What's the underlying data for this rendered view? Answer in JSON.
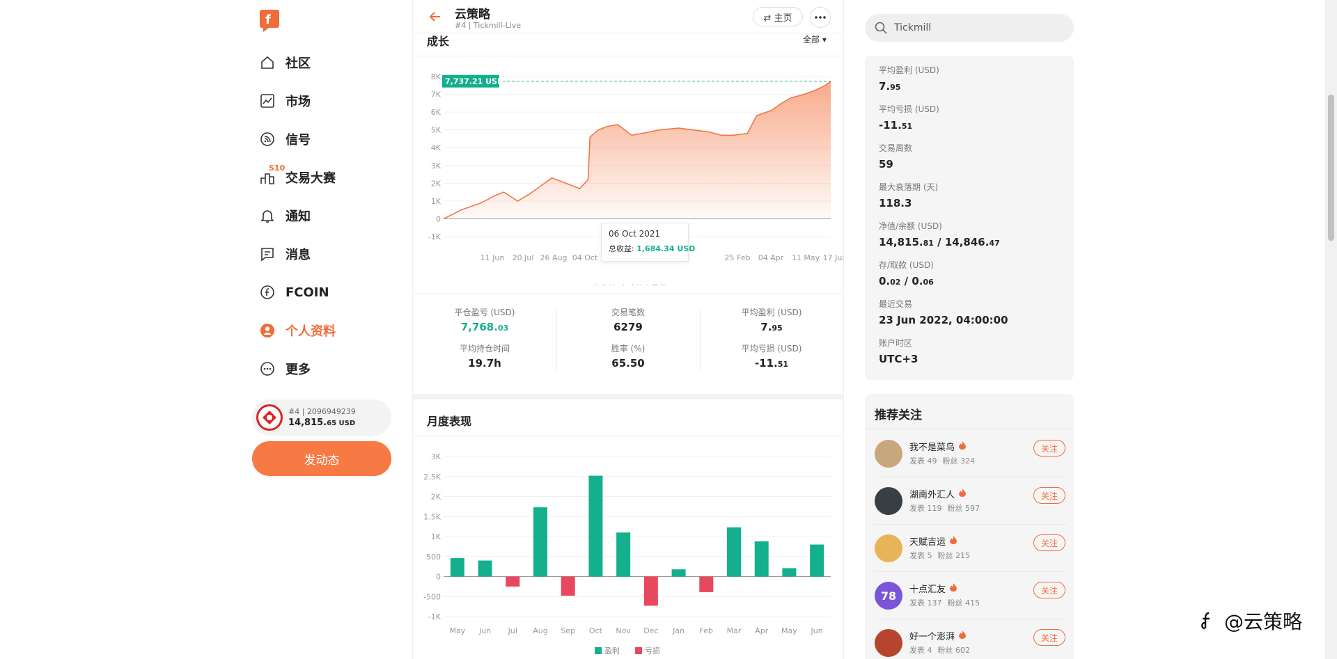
{
  "sidebar": {
    "items": [
      {
        "label": "社区",
        "icon": "home-icon"
      },
      {
        "label": "市场",
        "icon": "chart-line-icon"
      },
      {
        "label": "信号",
        "icon": "rss-icon"
      },
      {
        "label": "交易大赛",
        "icon": "podium-icon",
        "badge": "S10"
      },
      {
        "label": "通知",
        "icon": "bell-icon"
      },
      {
        "label": "消息",
        "icon": "message-icon"
      },
      {
        "label": "FCOIN",
        "icon": "fcoin-icon"
      },
      {
        "label": "个人资料",
        "icon": "user-icon"
      },
      {
        "label": "更多",
        "icon": "more-circle-icon"
      }
    ],
    "account": {
      "id": "#4 | 2096949239",
      "balance_main": "14,815.",
      "balance_sub": "65 USD"
    },
    "post_button": "发动态"
  },
  "header": {
    "title": "云策略",
    "subtitle": "#4 | Tickmill-Live",
    "home_label": "⇄ 主页"
  },
  "growth": {
    "title": "成长",
    "filter": "全部 ▾",
    "tooltip": {
      "date": "06 Oct 2021",
      "label": "总收益: ",
      "value": "1,684.34 USD"
    },
    "last_value_label": "7,737.21 USD"
  },
  "stats": [
    {
      "label": "平仓盈亏 (USD)",
      "main": "7,768.",
      "sub": "03",
      "green": true
    },
    {
      "label": "交易笔数",
      "main": "6279",
      "sub": ""
    },
    {
      "label": "平均盈利 (USD)",
      "main": "7.",
      "sub": "95"
    },
    {
      "label": "平均持仓时间",
      "main": "19.7h",
      "sub": ""
    },
    {
      "label": "胜率 (%)",
      "main": "65.50",
      "sub": ""
    },
    {
      "label": "平均亏损 (USD)",
      "main": "-11.",
      "sub": "51"
    }
  ],
  "monthly": {
    "title": "月度表现"
  },
  "search": {
    "value": "Tickmill"
  },
  "info": [
    {
      "label": "平均盈利 (USD)",
      "main": "7.",
      "sub": "95",
      "rest": ""
    },
    {
      "label": "平均亏损 (USD)",
      "main": "-11.",
      "sub": "51",
      "rest": ""
    },
    {
      "label": "交易周数",
      "main": "59",
      "sub": "",
      "rest": ""
    },
    {
      "label": "最大衰落期 (天)",
      "main": "118.3",
      "sub": "",
      "rest": ""
    },
    {
      "label": "净值/余额 (USD)",
      "main": "14,815.",
      "sub": "81",
      "rest": " / 14,846.",
      "rest_sub": "47"
    },
    {
      "label": "存/取款 (USD)",
      "main": "0.",
      "sub": "02",
      "rest": " / 0.",
      "rest_sub": "06"
    },
    {
      "label": "最近交易",
      "main": "23 Jun 2022, 04:00:00",
      "sub": "",
      "rest": ""
    },
    {
      "label": "账户时区",
      "main": "UTC+3",
      "sub": "",
      "rest": ""
    }
  ],
  "recommend": {
    "title": "推荐关注",
    "follow_label": "关注",
    "users": [
      {
        "name": "我不是菜鸟",
        "posts": "发表 49",
        "fans": "粉丝 324",
        "avatar_color": "#c9a77c",
        "avatar_text": ""
      },
      {
        "name": "湖南外汇人",
        "posts": "发表 119",
        "fans": "粉丝 597",
        "avatar_color": "#3a3f44",
        "avatar_text": ""
      },
      {
        "name": "天赋吉运",
        "posts": "发表 5",
        "fans": "粉丝 215",
        "avatar_color": "#e8b45a",
        "avatar_text": ""
      },
      {
        "name": "十点汇友",
        "posts": "发表 137",
        "fans": "粉丝 415",
        "avatar_color": "#7a55d8",
        "avatar_text": "78"
      },
      {
        "name": "好一个澎湃",
        "posts": "发表 4",
        "fans": "粉丝 602",
        "avatar_color": "#b5452f",
        "avatar_text": ""
      }
    ]
  },
  "watermark": "@云策略",
  "chart_data": [
    {
      "type": "area",
      "title": "成长",
      "series": [
        {
          "name": "总收益 (包含持仓盈亏)"
        }
      ],
      "x_ticks": [
        "11 Jun",
        "20 Jul",
        "26 Aug",
        "04 Oct",
        "",
        "",
        "25 Feb",
        "04 Apr",
        "11 May",
        "17 Jun"
      ],
      "y_ticks": [
        "8K",
        "7K",
        "6K",
        "5K",
        "4K",
        "3K",
        "2K",
        "1K",
        "0",
        "-1K"
      ],
      "ylim": [
        -1000,
        8000
      ],
      "x": [
        "2021-05-01",
        "2021-05-20",
        "2021-06-11",
        "2021-06-25",
        "2021-07-05",
        "2021-07-20",
        "2021-08-02",
        "2021-08-10",
        "2021-08-26",
        "2021-09-05",
        "2021-09-15",
        "2021-09-25",
        "2021-10-04",
        "2021-10-06",
        "2021-10-15",
        "2021-10-25",
        "2021-11-05",
        "2021-11-20",
        "2021-12-01",
        "2021-12-20",
        "2022-01-10",
        "2022-01-25",
        "2022-02-10",
        "2022-02-25",
        "2022-03-10",
        "2022-03-25",
        "2022-04-04",
        "2022-04-20",
        "2022-05-01",
        "2022-05-11",
        "2022-05-25",
        "2022-06-05",
        "2022-06-17",
        "2022-06-23"
      ],
      "y": [
        0,
        500,
        900,
        1300,
        1500,
        1000,
        1400,
        1700,
        2300,
        2100,
        1900,
        1700,
        2200,
        4600,
        5000,
        5200,
        5300,
        4700,
        4800,
        5000,
        5100,
        5000,
        4900,
        4700,
        4700,
        4800,
        5800,
        6100,
        6500,
        6800,
        7000,
        7200,
        7500,
        7737.21
      ],
      "last_value": 7737.21
    },
    {
      "type": "bar",
      "title": "月度表现",
      "categories": [
        "May",
        "Jun",
        "Jul",
        "Aug",
        "Sep",
        "Oct",
        "Nov",
        "Dec",
        "Jan",
        "Feb",
        "Mar",
        "Apr",
        "May",
        "Jun"
      ],
      "values": [
        460,
        400,
        -250,
        1730,
        -480,
        2520,
        1100,
        -730,
        180,
        -390,
        1230,
        880,
        210,
        800
      ],
      "y_ticks": [
        "3K",
        "2.5K",
        "2K",
        "1.5K",
        "1K",
        "500",
        "0",
        "-500",
        "-1K"
      ],
      "ylim": [
        -1000,
        3000
      ],
      "legend": [
        "盈利",
        "亏损"
      ],
      "colors": {
        "profit": "#14b08d",
        "loss": "#e8485e"
      }
    }
  ],
  "colors": {
    "accent": "#f06d3a",
    "green": "#14b08d",
    "red": "#e8485e",
    "area": "#f7a27e"
  }
}
